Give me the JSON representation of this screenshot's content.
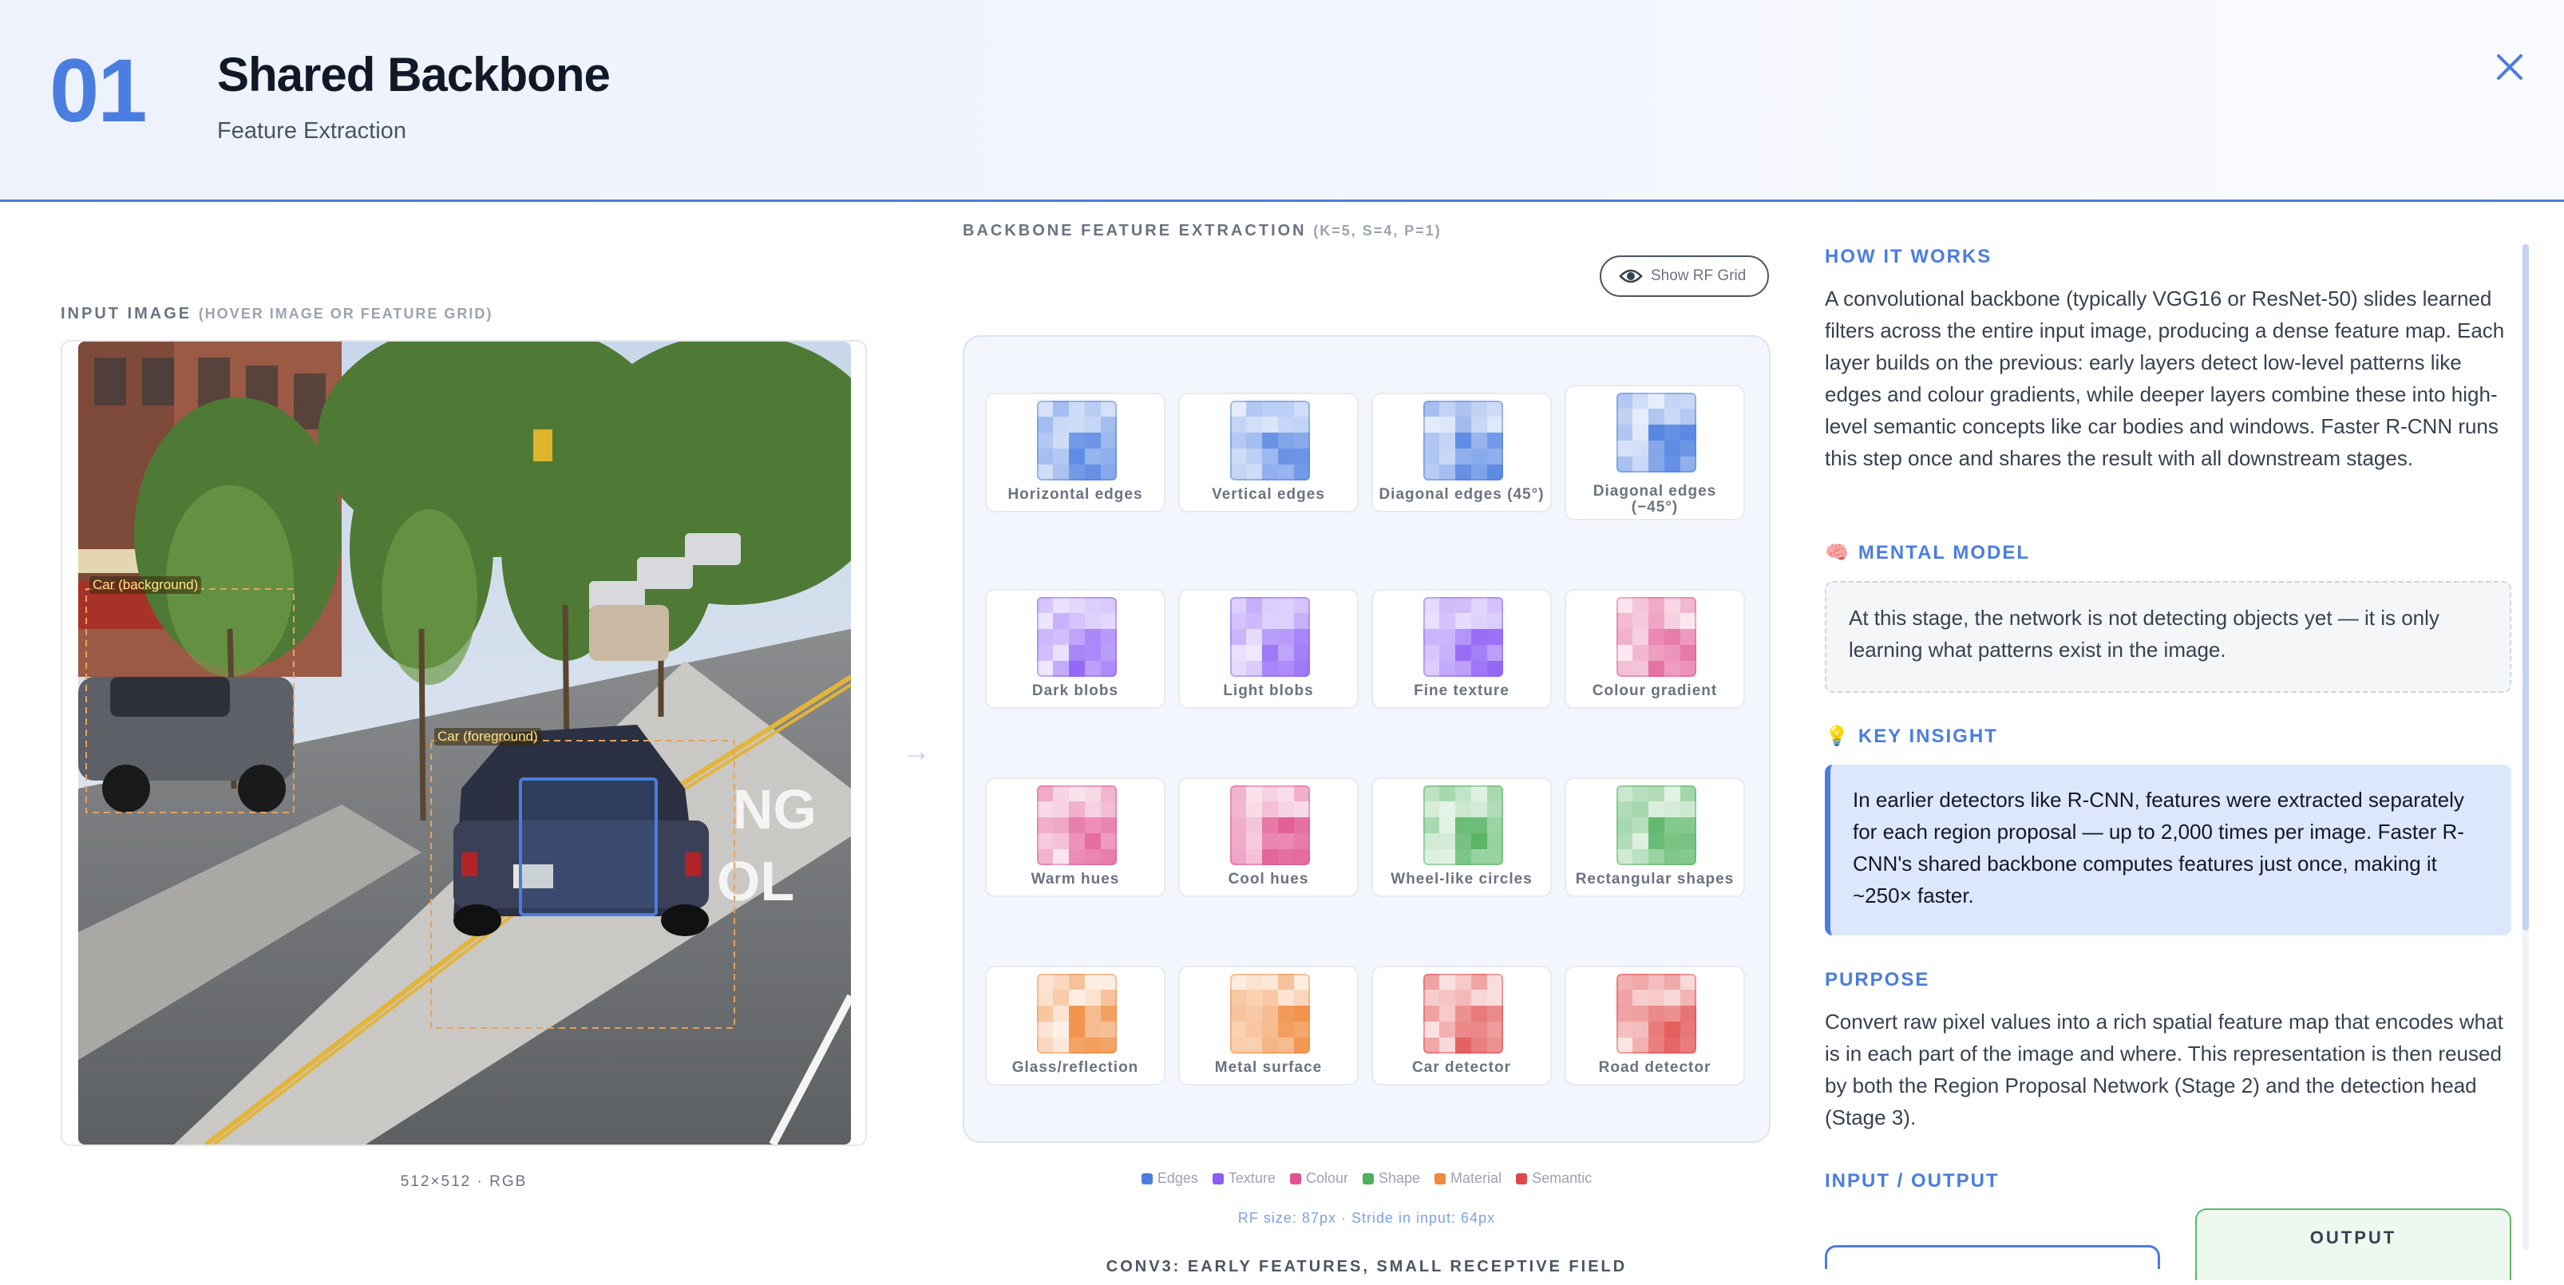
{
  "header": {
    "step": "01",
    "title": "Shared Backbone",
    "subtitle": "Feature Extraction"
  },
  "input_image": {
    "label": "INPUT IMAGE",
    "hint": "(HOVER IMAGE OR FEATURE GRID)",
    "dims": "512×512 · RGB",
    "detections": [
      "Car (background)",
      "Car (foreground)"
    ],
    "road_text": [
      "NG",
      "OL"
    ]
  },
  "backbone": {
    "label": "BACKBONE FEATURE EXTRACTION",
    "params": "(K=5, S=4, P=1)",
    "rf_button": "Show RF Grid",
    "features": [
      {
        "label": "Horizontal edges",
        "color": "#4a7de0"
      },
      {
        "label": "Vertical edges",
        "color": "#4a7de0"
      },
      {
        "label": "Diagonal edges (45°)",
        "color": "#4a7de0"
      },
      {
        "label": "Diagonal edges (−45°)",
        "color": "#4a7de0"
      },
      {
        "label": "Dark blobs",
        "color": "#8b5cf6"
      },
      {
        "label": "Light blobs",
        "color": "#8b5cf6"
      },
      {
        "label": "Fine texture",
        "color": "#8b5cf6"
      },
      {
        "label": "Colour gradient",
        "color": "#e0538f"
      },
      {
        "label": "Warm hues",
        "color": "#e0538f"
      },
      {
        "label": "Cool hues",
        "color": "#e0538f"
      },
      {
        "label": "Wheel-like circles",
        "color": "#4caf5a"
      },
      {
        "label": "Rectangular shapes",
        "color": "#4caf5a"
      },
      {
        "label": "Glass/reflection",
        "color": "#f08a3c"
      },
      {
        "label": "Metal surface",
        "color": "#f08a3c"
      },
      {
        "label": "Car detector",
        "color": "#e04848"
      },
      {
        "label": "Road detector",
        "color": "#e04848"
      }
    ],
    "legend": [
      {
        "label": "Edges",
        "color": "#4a7de0"
      },
      {
        "label": "Texture",
        "color": "#8b5cf6"
      },
      {
        "label": "Colour",
        "color": "#e0538f"
      },
      {
        "label": "Shape",
        "color": "#4caf5a"
      },
      {
        "label": "Material",
        "color": "#f08a3c"
      },
      {
        "label": "Semantic",
        "color": "#e04848"
      }
    ],
    "rf_info": "RF size: 87px · Stride in input: 64px",
    "layer_caption": "CONV3: EARLY FEATURES, SMALL RECEPTIVE FIELD"
  },
  "sidebar": {
    "how_title": "HOW IT WORKS",
    "how_text": "A convolutional backbone (typically VGG16 or ResNet-50) slides learned filters across the entire input image, producing a dense feature map. Each layer builds on the previous: early layers detect low-level patterns like edges and colour gradients, while deeper layers combine these into high-level semantic concepts like car bodies and windows. Faster R-CNN runs this step once and shares the result with all downstream stages.",
    "mental_title": "MENTAL MODEL",
    "mental_icon": "brain-icon",
    "mental_text": "At this stage, the network is not detecting objects yet — it is only learning what patterns exist in the image.",
    "insight_title": "KEY INSIGHT",
    "insight_icon": "lightbulb-icon",
    "insight_text": "In earlier detectors like R-CNN, features were extracted separately for each region proposal — up to 2,000 times per image. Faster R-CNN's shared backbone computes features just once, making it ~250× faster.",
    "purpose_title": "PURPOSE",
    "purpose_text": "Convert raw pixel values into a rich spatial feature map that encodes what is in each part of the image and where. This representation is then reused by both the Region Proposal Network (Stage 2) and the detection head (Stage 3).",
    "io_title": "INPUT / OUTPUT",
    "io_output": "OUTPUT"
  }
}
